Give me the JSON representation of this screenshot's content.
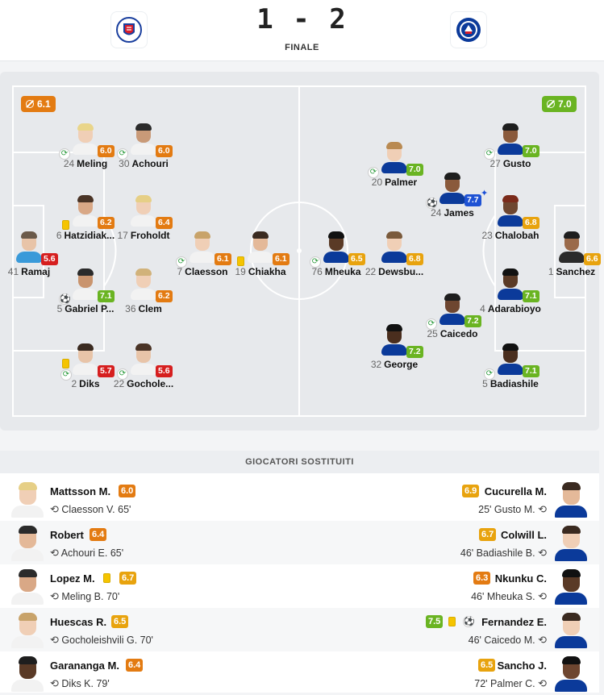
{
  "header": {
    "home_score": "1",
    "separator": "-",
    "away_score": "2",
    "status": "FINALE",
    "home_crest_icon": "fc-kobenhavn-crest-icon",
    "away_crest_icon": "chelsea-crest-icon"
  },
  "pitch": {
    "home_team_rating": "6.1",
    "away_team_rating": "7.0",
    "home_players": [
      {
        "num": "41",
        "name": "Ramaj",
        "rating": "5.6",
        "rating_color": "#d61f1f"
      },
      {
        "num": "24",
        "name": "Meling",
        "rating": "6.0",
        "rating_color": "#e37b12"
      },
      {
        "num": "30",
        "name": "Achouri",
        "rating": "6.0",
        "rating_color": "#e37b12"
      },
      {
        "num": "6",
        "name": "Hatzidiak...",
        "rating": "6.2",
        "rating_color": "#e37b12"
      },
      {
        "num": "17",
        "name": "Froholdt",
        "rating": "6.4",
        "rating_color": "#e37b12"
      },
      {
        "num": "7",
        "name": "Claesson",
        "rating": "6.1",
        "rating_color": "#e37b12"
      },
      {
        "num": "19",
        "name": "Chiakha",
        "rating": "6.1",
        "rating_color": "#e37b12"
      },
      {
        "num": "5",
        "name": "Gabriel P...",
        "rating": "7.1",
        "rating_color": "#6ab422"
      },
      {
        "num": "36",
        "name": "Clem",
        "rating": "6.2",
        "rating_color": "#e37b12"
      },
      {
        "num": "2",
        "name": "Diks",
        "rating": "5.7",
        "rating_color": "#d61f1f"
      },
      {
        "num": "22",
        "name": "Gochole...",
        "rating": "5.6",
        "rating_color": "#d61f1f"
      }
    ],
    "away_players": [
      {
        "num": "27",
        "name": "Gusto",
        "rating": "7.0",
        "rating_color": "#6ab422"
      },
      {
        "num": "20",
        "name": "Palmer",
        "rating": "7.0",
        "rating_color": "#6ab422"
      },
      {
        "num": "24",
        "name": "James",
        "rating": "7.7",
        "rating_color": "#1e52d4"
      },
      {
        "num": "23",
        "name": "Chalobah",
        "rating": "6.8",
        "rating_color": "#e8a30e"
      },
      {
        "num": "76",
        "name": "Mheuka",
        "rating": "6.5",
        "rating_color": "#e8a30e"
      },
      {
        "num": "22",
        "name": "Dewsbu...",
        "rating": "6.8",
        "rating_color": "#e8a30e"
      },
      {
        "num": "1",
        "name": "Sanchez",
        "rating": "6.6",
        "rating_color": "#e8a30e"
      },
      {
        "num": "4",
        "name": "Adarabioyo",
        "rating": "7.1",
        "rating_color": "#6ab422"
      },
      {
        "num": "25",
        "name": "Caicedo",
        "rating": "7.2",
        "rating_color": "#6ab422"
      },
      {
        "num": "32",
        "name": "George",
        "rating": "7.2",
        "rating_color": "#6ab422"
      },
      {
        "num": "5",
        "name": "Badiashile",
        "rating": "7.1",
        "rating_color": "#6ab422"
      }
    ]
  },
  "substitutes": {
    "title": "GIOCATORI SOSTITUITI",
    "home": [
      {
        "name": "Mattsson M.",
        "rating": "6.0",
        "rating_color": "#e37b12",
        "replaced": "Claesson V. 65'"
      },
      {
        "name": "Robert",
        "rating": "6.4",
        "rating_color": "#e37b12",
        "replaced": "Achouri E. 65'"
      },
      {
        "name": "Lopez M.",
        "rating": "6.7",
        "rating_color": "#e8a30e",
        "replaced": "Meling B. 70'"
      },
      {
        "name": "Huescas R.",
        "rating": "6.5",
        "rating_color": "#e8a30e",
        "replaced": "Gocholeishvili G. 70'"
      },
      {
        "name": "Garananga M.",
        "rating": "6.4",
        "rating_color": "#e37b12",
        "replaced": "Diks K. 79'"
      }
    ],
    "away": [
      {
        "name": "Cucurella M.",
        "rating": "6.9",
        "rating_color": "#e8a30e",
        "replaced": "25' Gusto M."
      },
      {
        "name": "Colwill L.",
        "rating": "6.7",
        "rating_color": "#e8a30e",
        "replaced": "46' Badiashile B."
      },
      {
        "name": "Nkunku C.",
        "rating": "6.3",
        "rating_color": "#e37b12",
        "replaced": "46' Mheuka S."
      },
      {
        "name": "Fernandez E.",
        "rating": "7.5",
        "rating_color": "#6ab422",
        "replaced": "46' Caicedo M."
      },
      {
        "name": "Sancho J.",
        "rating": "6.5",
        "rating_color": "#e8a30e",
        "replaced": "72' Palmer C."
      }
    ]
  }
}
